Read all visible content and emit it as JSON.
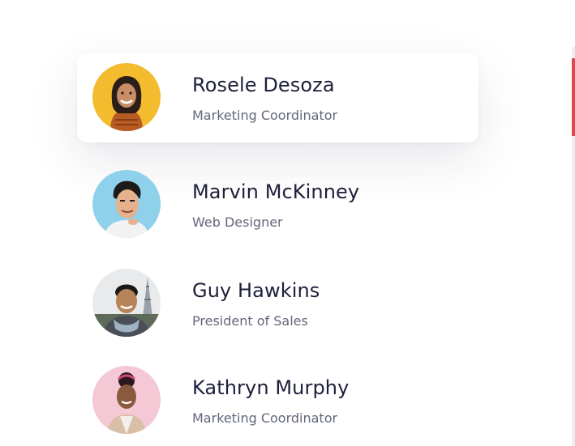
{
  "people": [
    {
      "name": "Rosele Desoza",
      "role": "Marketing Coordinator",
      "avatar": "woman-avatar-yellow",
      "active": true
    },
    {
      "name": "Marvin McKinney",
      "role": "Web Designer",
      "avatar": "man-avatar-blue",
      "active": false
    },
    {
      "name": "Guy Hawkins",
      "role": "President of Sales",
      "avatar": "man-avatar-eiffel",
      "active": false
    },
    {
      "name": "Kathryn Murphy",
      "role": "Marketing Coordinator",
      "avatar": "woman-avatar-pink",
      "active": false
    }
  ],
  "colors": {
    "name_text": "#1e1f3b",
    "role_text": "#63667a",
    "scroll_thumb": "#e0484b",
    "scroll_track": "#eceef2"
  }
}
